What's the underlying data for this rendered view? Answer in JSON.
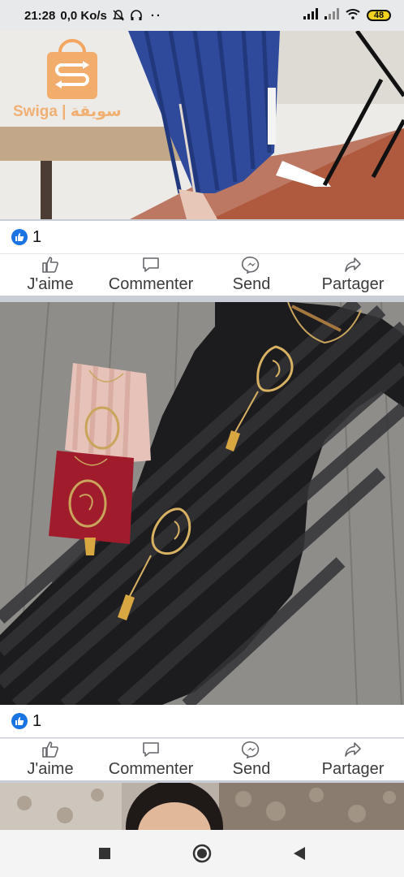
{
  "status_bar": {
    "time": "21:28",
    "network": "0,0 Ko/s",
    "battery": "48"
  },
  "watermark": {
    "text": "Swiga | سويقة"
  },
  "posts": [
    {
      "reaction_count": "1"
    },
    {
      "reaction_count": "1"
    }
  ],
  "actions": {
    "like": "J'aime",
    "comment": "Commenter",
    "send": "Send",
    "share": "Partager"
  },
  "colors": {
    "facebook_blue": "#1b74e4",
    "watermark_orange": "#f3a65f",
    "dress_blue": "#2f4a9a",
    "dress_black": "#1c1c1e",
    "burgundy": "#a01c2c",
    "pink": "#e7c2b8"
  },
  "icons": {
    "like": "thumbs-up-icon",
    "comment": "comment-bubble-icon",
    "send": "messenger-icon",
    "share": "share-arrow-icon"
  }
}
